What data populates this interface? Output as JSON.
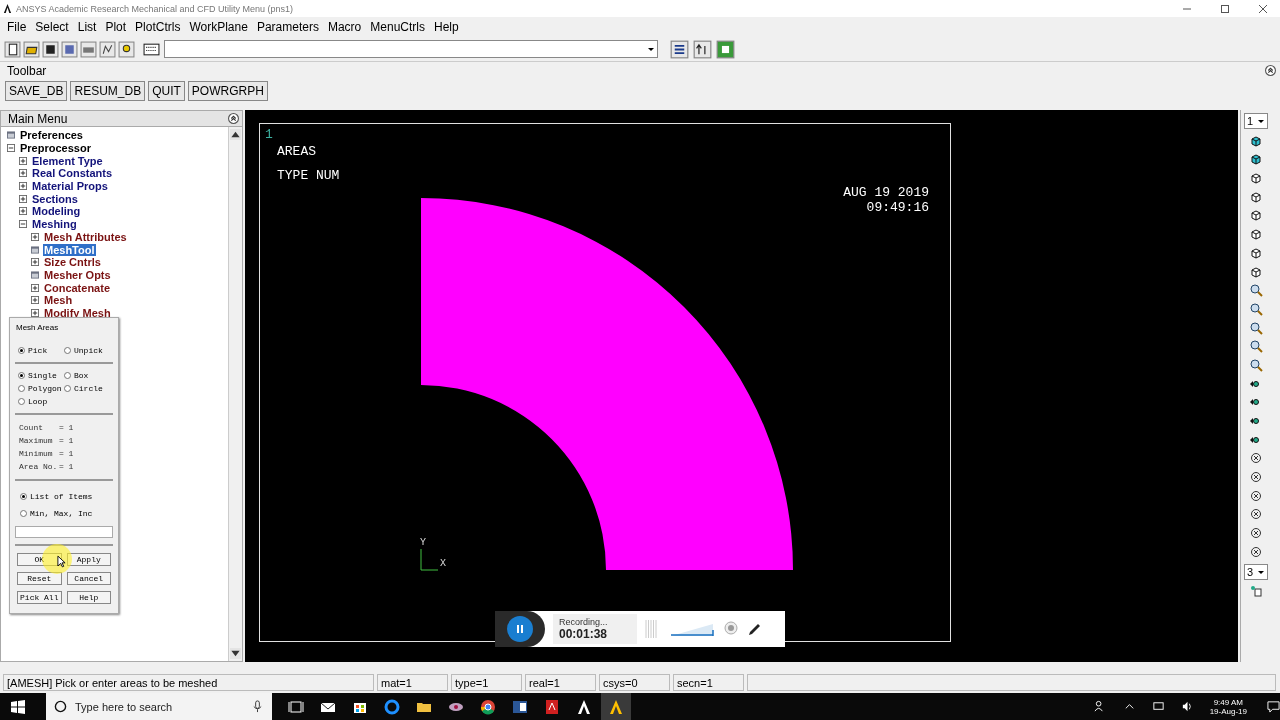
{
  "window": {
    "title": "ANSYS Academic Research Mechanical and CFD Utility Menu (pns1)"
  },
  "menu": [
    "File",
    "Select",
    "List",
    "Plot",
    "PlotCtrls",
    "WorkPlane",
    "Parameters",
    "Macro",
    "MenuCtrls",
    "Help"
  ],
  "toolbar": {
    "label": "Toolbar",
    "buttons": [
      "SAVE_DB",
      "RESUM_DB",
      "QUIT",
      "POWRGRPH"
    ]
  },
  "main_menu": {
    "title": "Main Menu",
    "tree": [
      {
        "label": "Preferences",
        "kind": "dialog",
        "selected": false
      },
      {
        "label": "Preprocessor",
        "kind": "branch",
        "expanded": true,
        "selected": false,
        "children": [
          {
            "label": "Element Type",
            "kind": "branch",
            "expanded": false,
            "selected": false
          },
          {
            "label": "Real Constants",
            "kind": "branch",
            "expanded": false,
            "selected": false
          },
          {
            "label": "Material Props",
            "kind": "branch",
            "expanded": false,
            "selected": false
          },
          {
            "label": "Sections",
            "kind": "branch",
            "expanded": false,
            "selected": false
          },
          {
            "label": "Modeling",
            "kind": "branch",
            "expanded": false,
            "selected": false
          },
          {
            "label": "Meshing",
            "kind": "branch",
            "expanded": true,
            "selected": false,
            "children": [
              {
                "label": "Mesh Attributes",
                "kind": "branch",
                "expanded": false,
                "selected": false
              },
              {
                "label": "MeshTool",
                "kind": "dialog",
                "selected": true
              },
              {
                "label": "Size Cntrls",
                "kind": "branch",
                "expanded": false,
                "selected": false
              },
              {
                "label": "Mesher Opts",
                "kind": "dialog",
                "selected": false
              },
              {
                "label": "Concatenate",
                "kind": "branch",
                "expanded": false,
                "selected": false
              },
              {
                "label": "Mesh",
                "kind": "branch",
                "expanded": false,
                "selected": false
              },
              {
                "label": "Modify Mesh",
                "kind": "branch",
                "expanded": false,
                "selected": false
              }
            ]
          }
        ]
      }
    ]
  },
  "graphics": {
    "window_number": "1",
    "labels": [
      "AREAS",
      "TYPE NUM"
    ],
    "date": "AUG 19 2019",
    "time": "09:49:16",
    "axis_y": "Y",
    "axis_x": "X"
  },
  "right_toolbar": {
    "top_select": "1",
    "bottom_select": "3"
  },
  "dialog": {
    "title": "Mesh Areas",
    "pick_modes": [
      {
        "label": "Pick",
        "selected": true
      },
      {
        "label": "Unpick",
        "selected": false
      }
    ],
    "shapes": [
      {
        "label": "Single",
        "selected": true
      },
      {
        "label": "Box",
        "selected": false
      },
      {
        "label": "Polygon",
        "selected": false
      },
      {
        "label": "Circle",
        "selected": false
      },
      {
        "label": "Loop",
        "selected": false
      }
    ],
    "stats": [
      {
        "label": "Count",
        "value": "= 1"
      },
      {
        "label": "Maximum",
        "value": "= 1"
      },
      {
        "label": "Minimum",
        "value": "= 1"
      },
      {
        "label": "Area No.",
        "value": "= 1"
      }
    ],
    "list_modes": [
      {
        "label": "List of Items",
        "selected": true
      },
      {
        "label": "Min, Max, Inc",
        "selected": false
      }
    ],
    "buttons": [
      "OK",
      "Apply",
      "Reset",
      "Cancel",
      "Pick All",
      "Help"
    ]
  },
  "recorder": {
    "status": "Recording...",
    "elapsed": "00:01:38"
  },
  "status_bar": {
    "message": "[AMESH]  Pick or enter areas to be meshed",
    "fields": [
      "mat=1",
      "type=1",
      "real=1",
      "csys=0",
      "secn=1"
    ]
  },
  "taskbar": {
    "search_placeholder": "Type here to search",
    "time": "9:49 AM",
    "date": "19-Aug-19"
  }
}
